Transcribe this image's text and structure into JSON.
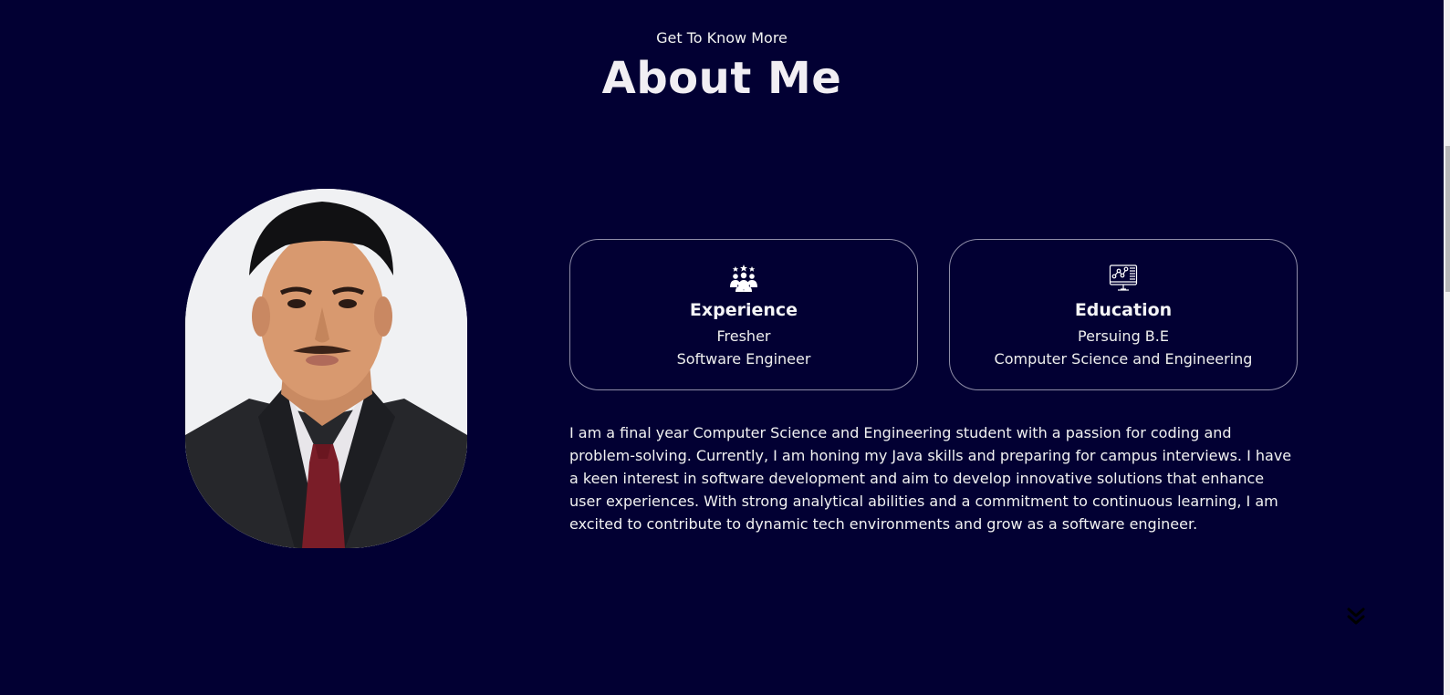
{
  "header": {
    "subtitle": "Get To Know More",
    "title": "About Me"
  },
  "cards": [
    {
      "icon": "team-icon",
      "heading": "Experience",
      "line1": "Fresher",
      "line2": "Software Engineer"
    },
    {
      "icon": "computer-chart-icon",
      "heading": "Education",
      "line1": "Persuing B.E",
      "line2": "Computer Science and Engineering"
    }
  ],
  "bio": "I am a final year Computer Science and Engineering student with a passion for coding and problem-solving. Currently, I am honing my Java skills and preparing for campus interviews. I have a keen interest in software development and aim to develop innovative solutions that enhance user experiences. With strong analytical abilities and a commitment to continuous learning, I am excited to contribute to dynamic tech environments and grow as a software engineer.",
  "icons": {
    "scroll_down": "double-chevron-down-icon"
  },
  "colors": {
    "background": "#020033",
    "text": "#f2f2f2",
    "card_border": "#8f8da8"
  }
}
